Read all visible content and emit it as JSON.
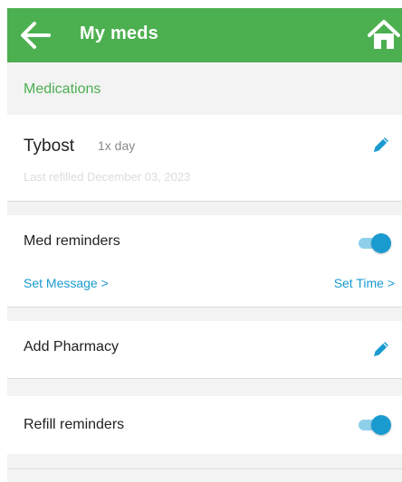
{
  "appbar": {
    "title": "My meds",
    "back_icon": "arrow-left-icon",
    "home_icon": "home-icon",
    "color": "#4caf50"
  },
  "section": {
    "label": "Medications"
  },
  "medication": {
    "name": "Tybost",
    "frequency": "1x day",
    "last_refilled": "Last refilled December 03, 2023",
    "edit_icon": "pencil-icon"
  },
  "med_reminders": {
    "label": "Med reminders",
    "enabled": true,
    "set_message": "Set Message >",
    "set_time": "Set Time >"
  },
  "pharmacy": {
    "label": "Add Pharmacy",
    "edit_icon": "pencil-icon"
  },
  "refill_reminders": {
    "label": "Refill reminders",
    "enabled": true
  },
  "colors": {
    "accent": "#1a9bd0",
    "section_label": "#4caf50"
  }
}
